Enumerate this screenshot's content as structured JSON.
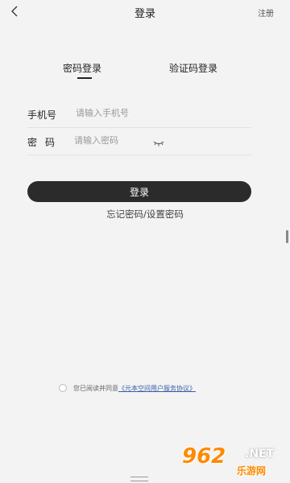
{
  "header": {
    "title": "登录",
    "register_label": "注册"
  },
  "tabs": [
    {
      "label": "密码登录",
      "active": true
    },
    {
      "label": "验证码登录",
      "active": false
    }
  ],
  "form": {
    "phone": {
      "label": "手机号",
      "placeholder": "请输入手机号",
      "value": ""
    },
    "password": {
      "label": "密码",
      "placeholder": "请输入密码",
      "value": ""
    }
  },
  "login_button": "登录",
  "forgot_link": "忘记密码/设置密码",
  "agreement": {
    "prefix": "您已阅读并同意",
    "link": "《元本空间用户服务协议》"
  },
  "watermark": {
    "number": "962",
    "suffix": ".NET",
    "site": "乐游网"
  },
  "icons": {
    "back": "chevron-left-icon",
    "eye": "eye-closed-icon"
  },
  "colors": {
    "background": "#f3f3f3",
    "button": "#2b2b2b",
    "link": "#3a5ea8",
    "watermark": "#ff8a00"
  }
}
